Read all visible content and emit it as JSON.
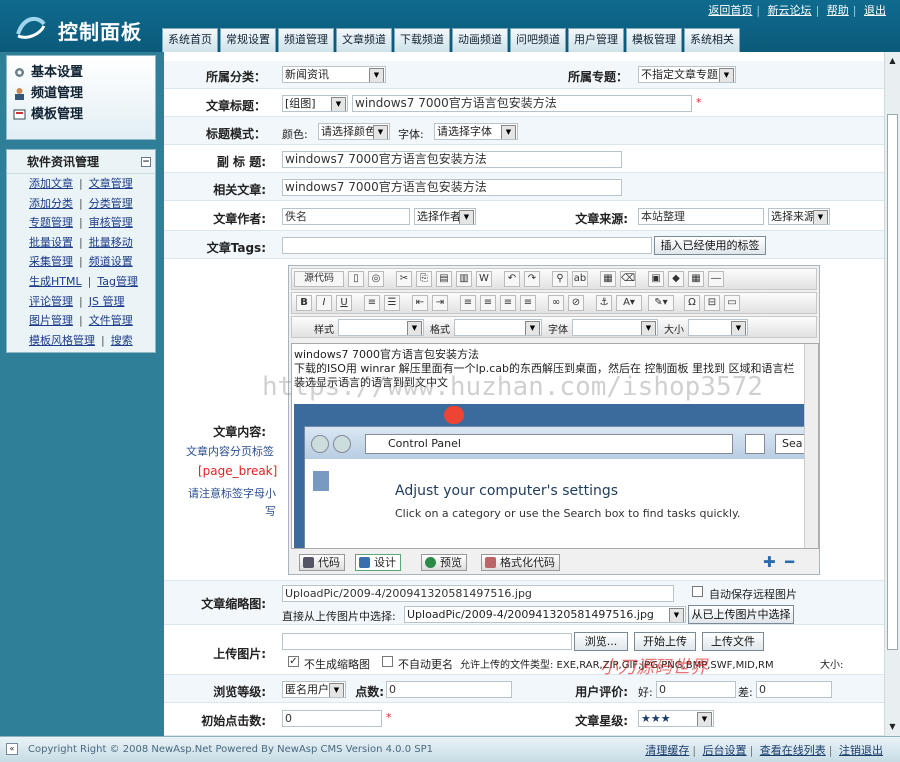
{
  "header": {
    "title": "控制面板",
    "links": [
      "返回首页",
      "新云论坛",
      "帮助",
      "退出"
    ]
  },
  "tabs": [
    "系统首页",
    "常规设置",
    "频道管理",
    "文章频道",
    "下载频道",
    "动画频道",
    "问吧频道",
    "用户管理",
    "模板管理",
    "系统相关"
  ],
  "sidebar": {
    "top_items": [
      {
        "label": "基本设置",
        "icon": "gear-icon"
      },
      {
        "label": "频道管理",
        "icon": "person-icon"
      },
      {
        "label": "模板管理",
        "icon": "template-icon"
      }
    ],
    "section_title": "软件资讯管理",
    "link_rows": [
      [
        "添加文章",
        "文章管理"
      ],
      [
        "添加分类",
        "分类管理"
      ],
      [
        "专题管理",
        "审核管理"
      ],
      [
        "批量设置",
        "批量移动"
      ],
      [
        "采集管理",
        "频道设置"
      ],
      [
        "生成HTML",
        "Tag管理"
      ],
      [
        "评论管理",
        "JS 管理"
      ],
      [
        "图片管理",
        "文件管理"
      ],
      [
        "模板风格管理",
        "搜索"
      ]
    ]
  },
  "form": {
    "category_label": "所属分类：",
    "category_value": "新闻资讯",
    "topic_label": "所属专题：",
    "topic_value": "不指定文章专题",
    "title_label": "文章标题：",
    "title_prefix": "[组图]",
    "title_value": "windows7 7000官方语言包安装方法",
    "style_label": "标题模式：",
    "color_label": "颜色:",
    "color_value": "请选择颜色",
    "font_label": "字体:",
    "font_value": "请选择字体",
    "subtitle_label": "副 标 题:",
    "subtitle_value": "windows7 7000官方语言包安装方法",
    "related_label": "相关文章:",
    "related_value": "windows7 7000官方语言包安装方法",
    "author_label": "文章作者:",
    "author_value": "佚名",
    "author_select": "选择作者",
    "source_label": "文章来源:",
    "source_value": "本站整理",
    "source_select": "选择来源",
    "tags_label": "文章Tags:",
    "tags_button": "插入已经使用的标签",
    "content_label": "文章内容:",
    "content_hint1": "文章内容分页标签",
    "content_hint2": "[page_break]",
    "content_hint3": "请注意标签字母小写",
    "thumb_label": "文章缩略图:",
    "thumb_value": "UploadPic/2009-4/200941320581497516.jpg",
    "thumb_auto": "自动保存远程图片",
    "thumb_pick_label": "直接从上传图片中选择:",
    "thumb_pick_value": "UploadPic/2009-4/200941320581497516.jpg",
    "thumb_pick_button": "从已上传图片中选择",
    "upload_label": "上传图片:",
    "browse_button": "浏览...",
    "start_upload": "开始上传",
    "upload_file": "上传文件",
    "no_thumb": "不生成缩略图",
    "no_rename": "不自动更名",
    "allowed_types": "允许上传的文件类型: EXE,RAR,ZIP,GIF,JPG,PNG,BMP,SWF,MID,RM",
    "size_label": "大小:",
    "level_label": "浏览等级:",
    "level_value": "匿名用户",
    "points_label": "点数:",
    "points_value": "0",
    "rating_label": "用户评价:",
    "good_label": "好:",
    "good_value": "0",
    "bad_label": "差:",
    "bad_value": "0",
    "hits_label": "初始点击数:",
    "hits_value": "0",
    "stars_label": "文章星级:",
    "stars_value": "★★★"
  },
  "editor": {
    "source_button": "源代码",
    "style_label": "样式",
    "format_label": "格式",
    "font_label": "字体",
    "size_label": "大小",
    "line1": "windows7 7000官方语言包安装方法",
    "line2": "下载的ISO用  winrar 解压里面有一个lp.cab的东西解压到桌面，然后在 控制面板 里找到 区域和语言栏",
    "line3": "装选显示语言的语言到到文中文",
    "shot_address": "Control Panel",
    "shot_search": "Sea",
    "shot_heading": "Adjust your computer's settings",
    "shot_sub": "Click on a category or use the Search box to find tasks quickly.",
    "modes": [
      "代码",
      "设计",
      "预览",
      "格式化代码"
    ]
  },
  "watermark": "https://www.huzhan.com/ishop3572",
  "watermark2": "小刀源码世界",
  "footer": {
    "copyright": "Copyright Right © 2008 NewAsp.Net Powered By NewAsp CMS Version 4.0.0 SP1",
    "links": [
      "清理缓存",
      "后台设置",
      "查看在线列表",
      "注销退出"
    ]
  },
  "colors": {
    "header": "#0f6b8e",
    "sidebar": "#2f7f99",
    "accent": "#d22222"
  }
}
